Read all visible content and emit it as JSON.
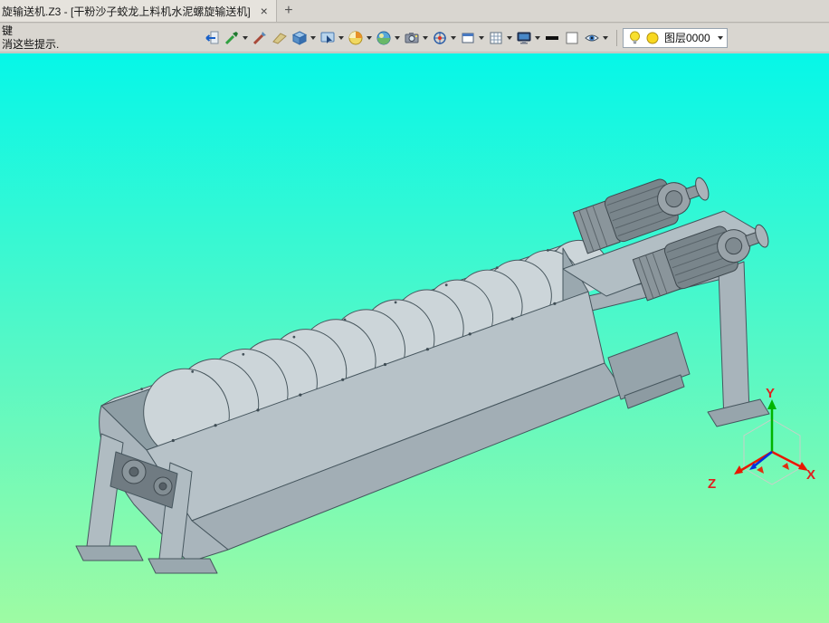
{
  "window": {
    "tab_title": "旋输送机.Z3 - [干粉沙子蛟龙上料机水泥螺旋输送机]",
    "close_glyph": "×",
    "new_tab_glyph": "+"
  },
  "message_hint": {
    "line1": "键",
    "line2": "消这些提示."
  },
  "toolbar": {
    "layer_selector": {
      "value": "图层0000",
      "swatch_color": "#f8d820"
    },
    "icons": [
      "exit-document-icon",
      "pick-filter-icon",
      "sketch-pen-icon",
      "section-blade-icon",
      "view-cube-icon",
      "display-select-icon",
      "color-wheel-icon",
      "render-sphere-icon",
      "camera-icon",
      "locate-icon",
      "window-icon",
      "grid-icon",
      "monitor-icon",
      "line-width-icon",
      "blank-swatch-icon",
      "visibility-eye-icon",
      "bulb-icon"
    ]
  },
  "viewport": {
    "background_top": "#06f7e8",
    "background_bottom": "#9efba3",
    "model": "screw-conveyor-3d-model"
  },
  "triad": {
    "x_label": "X",
    "y_label": "Y",
    "z_label": "Z",
    "label_color": "#e02020",
    "x_axis_color": "#e81800",
    "y_axis_color": "#00b400",
    "z_axis_color": "#e81800"
  }
}
